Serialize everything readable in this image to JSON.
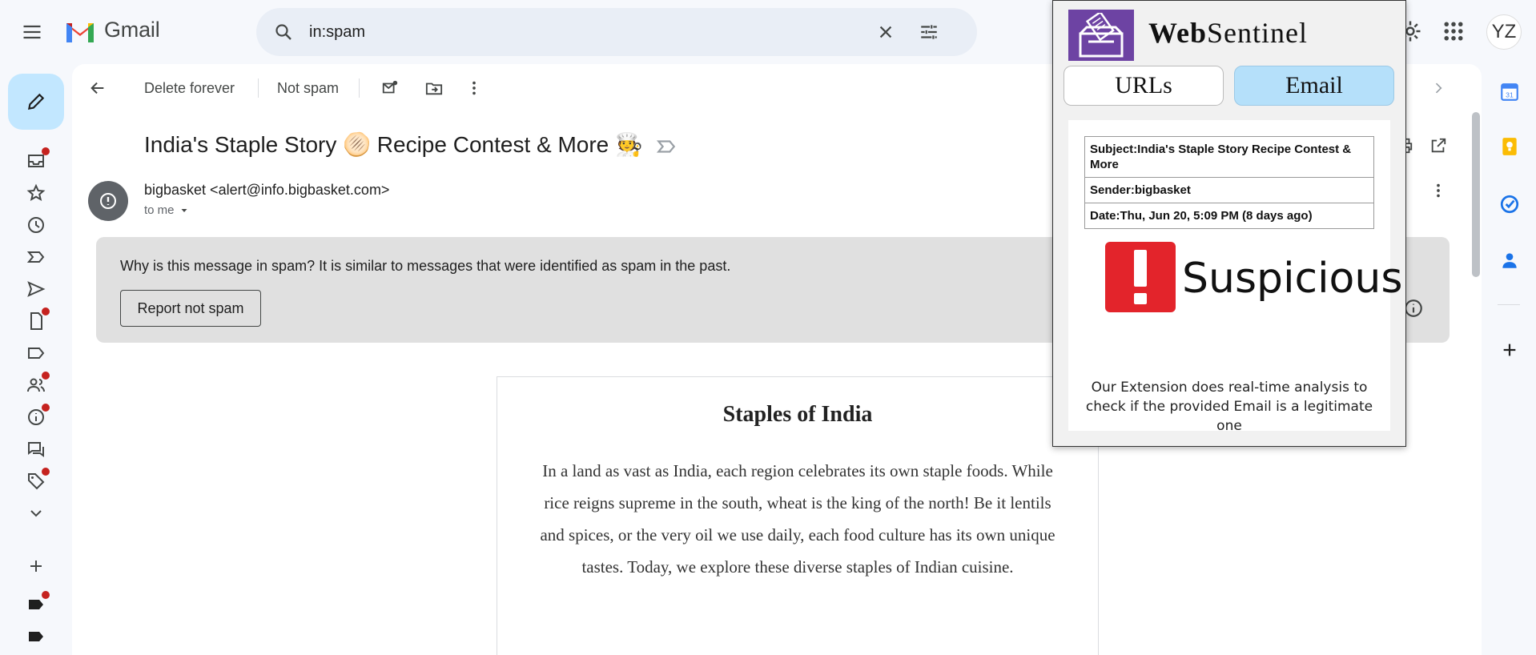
{
  "header": {
    "app_name": "Gmail",
    "search_value": "in:spam",
    "avatar_initials": "YZ"
  },
  "toolbar": {
    "delete_forever": "Delete forever",
    "not_spam": "Not spam"
  },
  "message": {
    "subject": "India's Staple Story 🫓 Recipe Contest & More 🧑‍🍳",
    "sender": "bigbasket <alert@info.bigbasket.com>",
    "recipient": "to me",
    "spam_reason_bold": "Why is this message in spam?",
    "spam_reason": " It is similar to messages that were identified as spam in the past.",
    "report_not_spam": "Report not spam"
  },
  "body": {
    "title": "Staples of India",
    "text": "In a land as vast as India, each region celebrates its own staple foods. While rice reigns supreme in the south, wheat is the king of the north! Be it lentils and spices, or the very oil we use daily, each food culture has its own unique tastes. Today, we explore these diverse staples of Indian cuisine."
  },
  "websentinel": {
    "title_bold": "Web",
    "title_rest": "Sentinel",
    "tabs": {
      "urls": "URLs",
      "email": "Email"
    },
    "active_tab": "Email",
    "subject_row": "Subject:India's Staple Story Recipe Contest & More",
    "sender_row": "Sender:bigbasket",
    "date_row": "Date:Thu, Jun 20, 5:09 PM (8 days ago)",
    "verdict": "Suspicious",
    "verdict_color": "#e3242b",
    "note": "Our Extension does real-time analysis to check if the provided Email is a legitimate one"
  },
  "colors": {
    "compose_bg": "#c2e7ff",
    "spam_banner_bg": "#e0e0e0",
    "notification_dot": "#c5221f",
    "ws_logo_bg": "#6d43a3",
    "ws_active_tab_bg": "#b5e0fa"
  },
  "icons": {
    "left_rail": [
      "inbox-icon",
      "star-icon",
      "snoozed-icon",
      "important-icon",
      "sent-icon",
      "drafts-icon",
      "label-icon",
      "contacts-icon",
      "info-icon",
      "chat-icon",
      "tag-icon",
      "more-icon"
    ],
    "right_rail": [
      "calendar-icon",
      "keep-icon",
      "tasks-icon",
      "contacts-icon",
      "add-icon"
    ]
  }
}
